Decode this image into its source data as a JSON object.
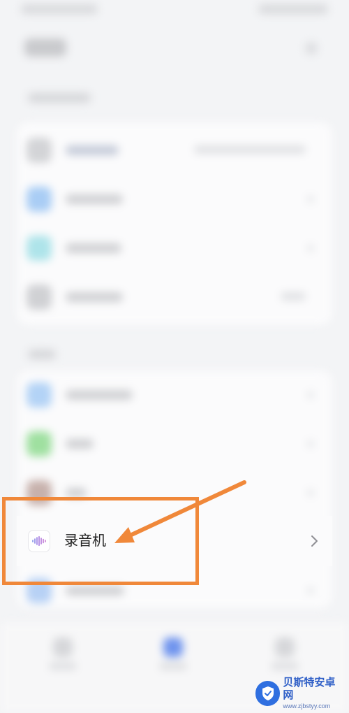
{
  "focused_item": {
    "label": "录音机",
    "icon": "waveform-icon",
    "chevron": "chevron-right-icon"
  },
  "annotation": {
    "color": "#f0883a",
    "arrow": "arrow-pointing-left-icon"
  },
  "watermark": {
    "title": "贝斯特安卓网",
    "url": "www.zjbstyy.com"
  },
  "colors": {
    "background": "#f3f4f6",
    "card": "#fbfbfc",
    "text": "#222222",
    "accent_blue": "#2f6fe0"
  }
}
